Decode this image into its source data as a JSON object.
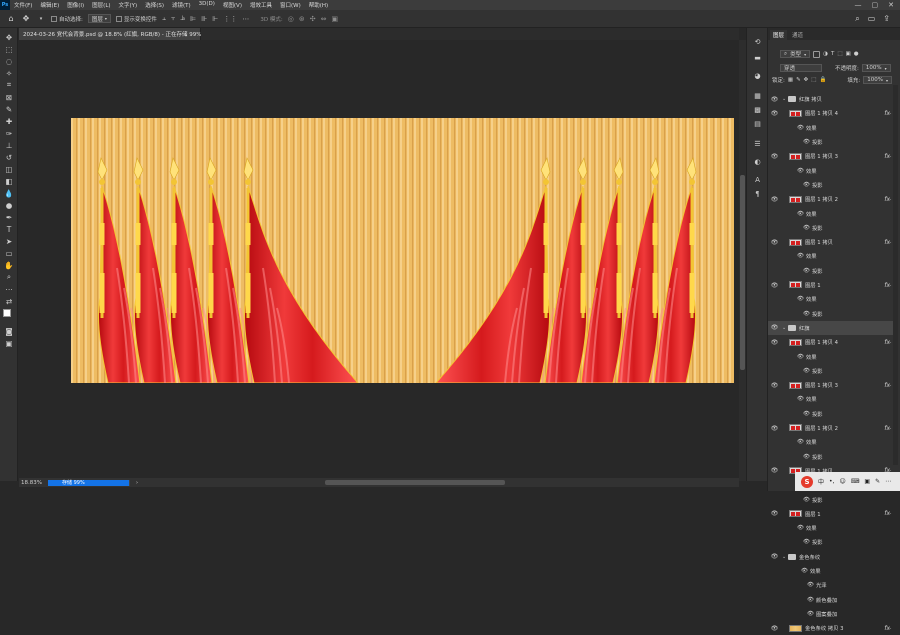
{
  "app": {
    "logo": "Ps",
    "menu": [
      "文件(F)",
      "编辑(E)",
      "图像(I)",
      "图层(L)",
      "文字(Y)",
      "选择(S)",
      "滤镜(T)",
      "3D(D)",
      "视图(V)",
      "增效工具",
      "窗口(W)",
      "帮助(H)"
    ],
    "window_controls": [
      "—",
      "▢",
      "✕"
    ]
  },
  "options_bar": {
    "auto_select_label": "自动选择:",
    "auto_select_value": "图层",
    "show_transform_label": "显示变换控件",
    "mode_label": "3D 模式:"
  },
  "document": {
    "tab_title": "2024-03-26 党代会背景.psd @ 18.8% (红旗, RGB/8) - 正在存储 99%",
    "close_glyph": "×"
  },
  "status": {
    "zoom": "18.83%",
    "progress_label": "存储",
    "progress_percent": "99%",
    "progress_fraction": 0.99
  },
  "panel": {
    "tabs": [
      "图层",
      "通道"
    ],
    "filter_kind": "类型",
    "blend_mode": "穿透",
    "opacity_label": "不透明度:",
    "opacity_value": "100%",
    "lock_label": "锁定:",
    "fill_label": "填充:",
    "fill_value": "100%"
  },
  "layers": [
    {
      "kind": "group",
      "name": "红旗 拷贝",
      "eye": true,
      "expanded": true
    },
    {
      "kind": "layer",
      "name": "图层 1 拷贝 4",
      "thumb": "red",
      "fx": true
    },
    {
      "kind": "effects",
      "name": "效果"
    },
    {
      "kind": "effect",
      "name": "投影"
    },
    {
      "kind": "layer",
      "name": "图层 1 拷贝 3",
      "thumb": "red",
      "fx": true
    },
    {
      "kind": "effects",
      "name": "效果"
    },
    {
      "kind": "effect",
      "name": "投影"
    },
    {
      "kind": "layer",
      "name": "图层 1 拷贝 2",
      "thumb": "red",
      "fx": true
    },
    {
      "kind": "effects",
      "name": "效果"
    },
    {
      "kind": "effect",
      "name": "投影"
    },
    {
      "kind": "layer",
      "name": "图层 1 拷贝",
      "thumb": "red",
      "fx": true
    },
    {
      "kind": "effects",
      "name": "效果"
    },
    {
      "kind": "effect",
      "name": "投影"
    },
    {
      "kind": "layer",
      "name": "图层 1",
      "thumb": "red",
      "fx": true
    },
    {
      "kind": "effects",
      "name": "效果"
    },
    {
      "kind": "effect",
      "name": "投影"
    },
    {
      "kind": "group",
      "name": "红旗",
      "eye": true,
      "expanded": true,
      "selected": true
    },
    {
      "kind": "layer",
      "name": "图层 1 拷贝 4",
      "thumb": "red",
      "fx": true
    },
    {
      "kind": "effects",
      "name": "效果"
    },
    {
      "kind": "effect",
      "name": "投影"
    },
    {
      "kind": "layer",
      "name": "图层 1 拷贝 3",
      "thumb": "red",
      "fx": true
    },
    {
      "kind": "effects",
      "name": "效果"
    },
    {
      "kind": "effect",
      "name": "投影"
    },
    {
      "kind": "layer",
      "name": "图层 1 拷贝 2",
      "thumb": "red",
      "fx": true
    },
    {
      "kind": "effects",
      "name": "效果"
    },
    {
      "kind": "effect",
      "name": "投影"
    },
    {
      "kind": "layer",
      "name": "图层 1 拷贝",
      "thumb": "red",
      "fx": true
    },
    {
      "kind": "effects",
      "name": "效果"
    },
    {
      "kind": "effect",
      "name": "投影"
    },
    {
      "kind": "layer",
      "name": "图层 1",
      "thumb": "red",
      "fx": true
    },
    {
      "kind": "effects",
      "name": "效果"
    },
    {
      "kind": "effect",
      "name": "投影"
    },
    {
      "kind": "group",
      "name": "金色条纹",
      "eye": true,
      "expanded": true
    },
    {
      "kind": "effects",
      "name": "效果",
      "indent": 1
    },
    {
      "kind": "effect",
      "name": "光泽",
      "indent": 1
    },
    {
      "kind": "effect",
      "name": "颜色叠加",
      "indent": 1
    },
    {
      "kind": "effect",
      "name": "图案叠加",
      "indent": 1
    },
    {
      "kind": "layer",
      "name": "金色条纹 拷贝 3",
      "thumb": "gold",
      "fx": true
    }
  ],
  "taskbar": {
    "ime_logo": "S",
    "ime_lang": "中",
    "items": [
      "•,",
      "☺",
      "⌨",
      "▣",
      "✎",
      "⋯"
    ]
  },
  "colors": {
    "flag_red": "#d81f1f",
    "gold_stripe": "#eebc63",
    "pole_gold": "#f3c534",
    "accent_blue": "#1473e6"
  }
}
